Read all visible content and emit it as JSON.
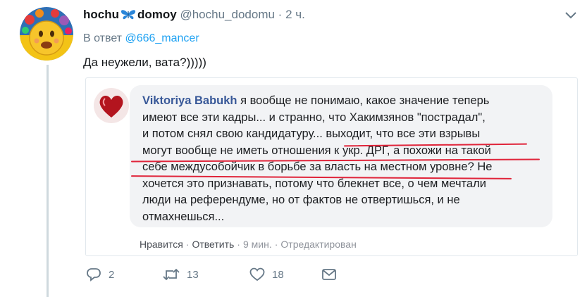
{
  "tweet": {
    "display_name_left": "hochu",
    "display_name_right": "domoy",
    "handle": "@hochu_dodomu",
    "separator": "·",
    "time": "2 ч.",
    "reply_prefix": "В ответ",
    "reply_mention": "@666_mancer",
    "text": "Да неужели, вата?)))))"
  },
  "embed": {
    "author": "Viktoriya Babukh",
    "lines": [
      " я вообще не понимаю, какое значение теперь",
      "имеют все эти кадры... и странно, что Хакимзянов \"пострадал\",",
      "и потом снял свою кандидатуру... выходит, что все эти взрывы",
      "могут вообще не иметь отношения к укр. ДРГ, а похожи на такой",
      "себе междусобойчик в борьбе за власть на местном уровне? Не",
      "хочется это признавать, потому что блекнет все, о чем мечтали",
      "люди на референдуме, но от фактов не отвертишься, и не",
      "отмахнешься..."
    ],
    "actions": {
      "like": "Нравится",
      "reply": "Ответить",
      "time": "9 мин.",
      "edited": "Отредактирован",
      "dot": "·"
    }
  },
  "actions": {
    "reply_count": "2",
    "retweet_count": "13",
    "like_count": "18"
  },
  "colors": {
    "accent": "#1da1f2",
    "fb_name": "#385898",
    "underline": "#e0243a",
    "muted": "#657786"
  },
  "icons": [
    "emoji-avatar-icon",
    "butterfly-icon",
    "chevron-down-icon",
    "heart-avatar-icon",
    "reply-icon",
    "retweet-icon",
    "like-icon",
    "direct-message-icon"
  ]
}
